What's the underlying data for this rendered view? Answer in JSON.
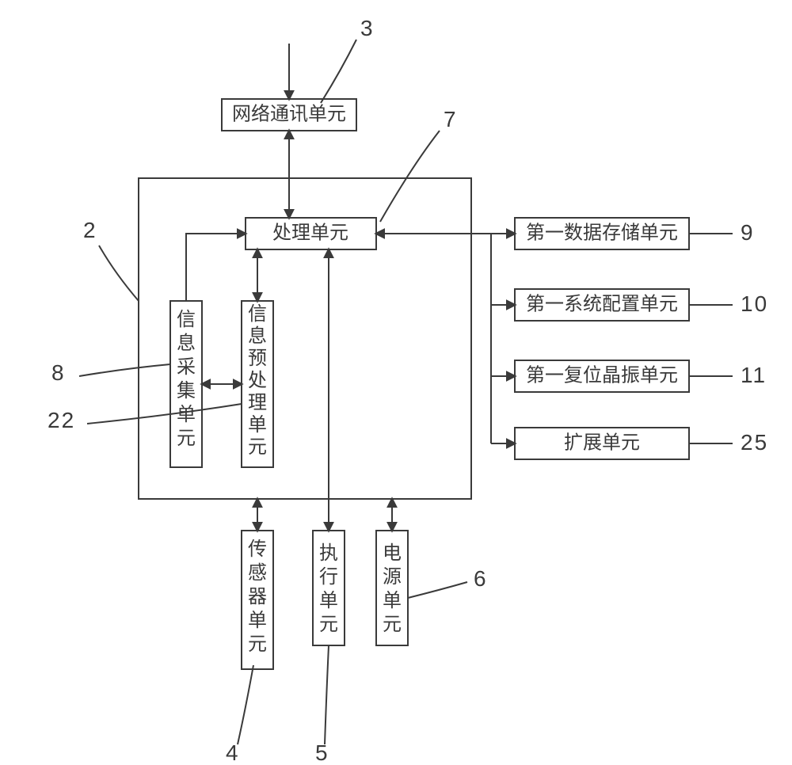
{
  "blocks": {
    "network": {
      "label": "网络通讯单元",
      "ref": "3"
    },
    "processing": {
      "label": "处理单元",
      "ref": "7"
    },
    "acquire": {
      "label": "信息采集单元",
      "ref": "8"
    },
    "preproc": {
      "label": "信息预处理单元",
      "ref": "22"
    },
    "sensor": {
      "label": "传感器单元",
      "ref": "4"
    },
    "exec": {
      "label": "执行单元",
      "ref": "5"
    },
    "power": {
      "label": "电源单元",
      "ref": "6"
    },
    "storage": {
      "label": "第一数据存储单元",
      "ref": "9"
    },
    "sysconf": {
      "label": "第一系统配置单元",
      "ref": "10"
    },
    "reset": {
      "label": "第一复位晶振单元",
      "ref": "11"
    },
    "ext": {
      "label": "扩展单元",
      "ref": "25"
    },
    "main_frame": {
      "ref": "2"
    }
  }
}
